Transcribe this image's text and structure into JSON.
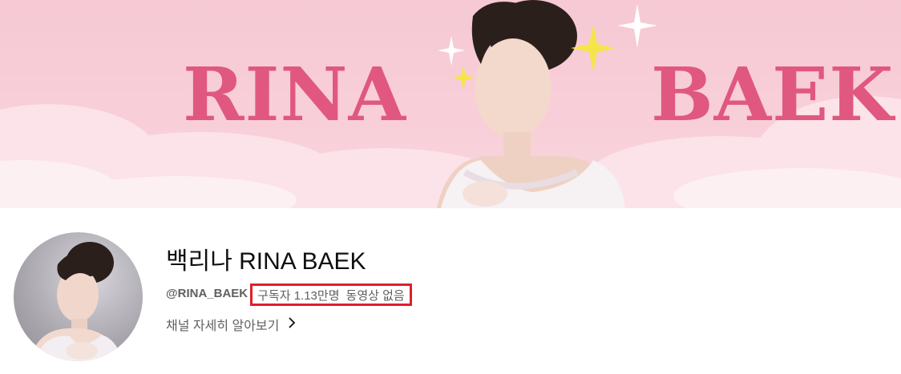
{
  "banner": {
    "left_text": "RINA",
    "right_text": "BAEK"
  },
  "channel": {
    "name": "백리나 RINA BAEK",
    "handle": "@RINA_BAEK",
    "subscribers": "구독자 1.13만명",
    "videos": "동영상 없음",
    "more_label": "채널 자세히 알아보기",
    "more_icon": "chevron-right-icon"
  },
  "colors": {
    "banner_pink": "#f6c9d4",
    "banner_text": "#e0587f",
    "highlight_box": "#e01e2d"
  }
}
